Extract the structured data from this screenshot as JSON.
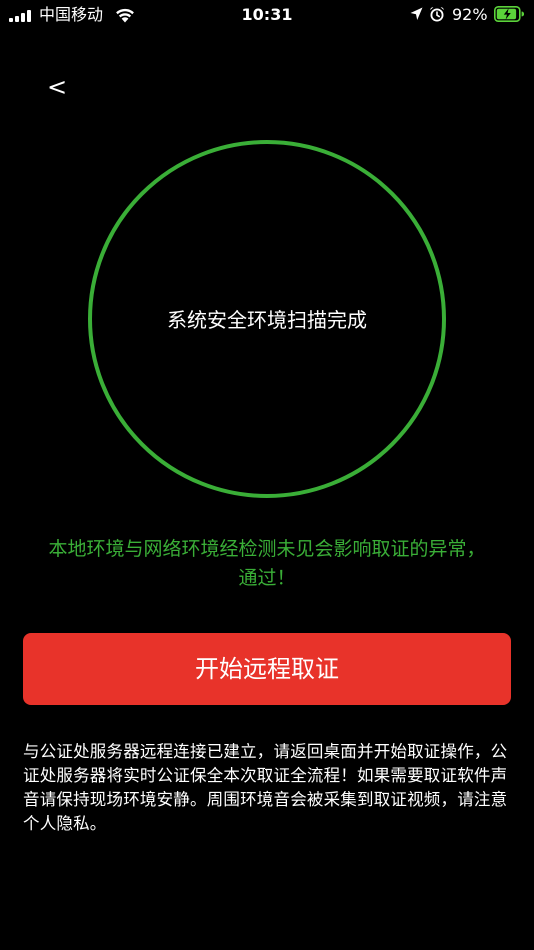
{
  "status_bar": {
    "carrier": "中国移动",
    "time": "10:31",
    "battery_percent": "92%",
    "battery_level": 0.92,
    "icons": [
      "signal-icon",
      "wifi-icon",
      "location-icon",
      "alarm-icon",
      "battery-icon"
    ]
  },
  "nav": {
    "back_label": "<"
  },
  "scan": {
    "status": "系统安全环境扫描完成",
    "ring_color": "#3aae37"
  },
  "result": {
    "message": "本地环境与网络环境经检测未见会影响取证的异常，通过！",
    "color": "#3aae37"
  },
  "actions": {
    "start_label": "开始远程取证",
    "button_color": "#e8332a"
  },
  "notice": {
    "text": "与公证处服务器远程连接已建立，请返回桌面并开始取证操作，公证处服务器将实时公证保全本次取证全流程！如果需要取证软件声音请保持现场环境安静。周围环境音会被采集到取证视频，请注意个人隐私。"
  }
}
